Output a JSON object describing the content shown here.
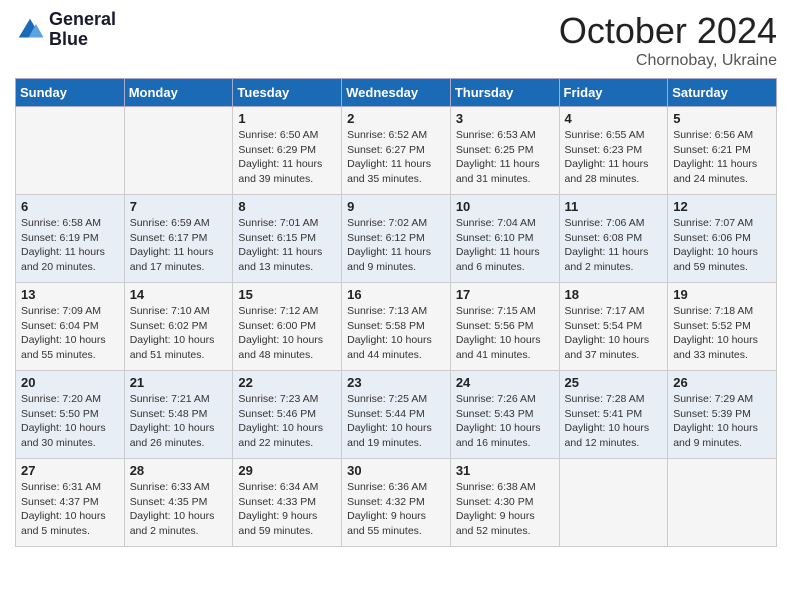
{
  "header": {
    "logo_line1": "General",
    "logo_line2": "Blue",
    "month": "October 2024",
    "location": "Chornobay, Ukraine"
  },
  "days_of_week": [
    "Sunday",
    "Monday",
    "Tuesday",
    "Wednesday",
    "Thursday",
    "Friday",
    "Saturday"
  ],
  "weeks": [
    [
      {
        "day": "",
        "info": ""
      },
      {
        "day": "",
        "info": ""
      },
      {
        "day": "1",
        "info": "Sunrise: 6:50 AM\nSunset: 6:29 PM\nDaylight: 11 hours and 39 minutes."
      },
      {
        "day": "2",
        "info": "Sunrise: 6:52 AM\nSunset: 6:27 PM\nDaylight: 11 hours and 35 minutes."
      },
      {
        "day": "3",
        "info": "Sunrise: 6:53 AM\nSunset: 6:25 PM\nDaylight: 11 hours and 31 minutes."
      },
      {
        "day": "4",
        "info": "Sunrise: 6:55 AM\nSunset: 6:23 PM\nDaylight: 11 hours and 28 minutes."
      },
      {
        "day": "5",
        "info": "Sunrise: 6:56 AM\nSunset: 6:21 PM\nDaylight: 11 hours and 24 minutes."
      }
    ],
    [
      {
        "day": "6",
        "info": "Sunrise: 6:58 AM\nSunset: 6:19 PM\nDaylight: 11 hours and 20 minutes."
      },
      {
        "day": "7",
        "info": "Sunrise: 6:59 AM\nSunset: 6:17 PM\nDaylight: 11 hours and 17 minutes."
      },
      {
        "day": "8",
        "info": "Sunrise: 7:01 AM\nSunset: 6:15 PM\nDaylight: 11 hours and 13 minutes."
      },
      {
        "day": "9",
        "info": "Sunrise: 7:02 AM\nSunset: 6:12 PM\nDaylight: 11 hours and 9 minutes."
      },
      {
        "day": "10",
        "info": "Sunrise: 7:04 AM\nSunset: 6:10 PM\nDaylight: 11 hours and 6 minutes."
      },
      {
        "day": "11",
        "info": "Sunrise: 7:06 AM\nSunset: 6:08 PM\nDaylight: 11 hours and 2 minutes."
      },
      {
        "day": "12",
        "info": "Sunrise: 7:07 AM\nSunset: 6:06 PM\nDaylight: 10 hours and 59 minutes."
      }
    ],
    [
      {
        "day": "13",
        "info": "Sunrise: 7:09 AM\nSunset: 6:04 PM\nDaylight: 10 hours and 55 minutes."
      },
      {
        "day": "14",
        "info": "Sunrise: 7:10 AM\nSunset: 6:02 PM\nDaylight: 10 hours and 51 minutes."
      },
      {
        "day": "15",
        "info": "Sunrise: 7:12 AM\nSunset: 6:00 PM\nDaylight: 10 hours and 48 minutes."
      },
      {
        "day": "16",
        "info": "Sunrise: 7:13 AM\nSunset: 5:58 PM\nDaylight: 10 hours and 44 minutes."
      },
      {
        "day": "17",
        "info": "Sunrise: 7:15 AM\nSunset: 5:56 PM\nDaylight: 10 hours and 41 minutes."
      },
      {
        "day": "18",
        "info": "Sunrise: 7:17 AM\nSunset: 5:54 PM\nDaylight: 10 hours and 37 minutes."
      },
      {
        "day": "19",
        "info": "Sunrise: 7:18 AM\nSunset: 5:52 PM\nDaylight: 10 hours and 33 minutes."
      }
    ],
    [
      {
        "day": "20",
        "info": "Sunrise: 7:20 AM\nSunset: 5:50 PM\nDaylight: 10 hours and 30 minutes."
      },
      {
        "day": "21",
        "info": "Sunrise: 7:21 AM\nSunset: 5:48 PM\nDaylight: 10 hours and 26 minutes."
      },
      {
        "day": "22",
        "info": "Sunrise: 7:23 AM\nSunset: 5:46 PM\nDaylight: 10 hours and 22 minutes."
      },
      {
        "day": "23",
        "info": "Sunrise: 7:25 AM\nSunset: 5:44 PM\nDaylight: 10 hours and 19 minutes."
      },
      {
        "day": "24",
        "info": "Sunrise: 7:26 AM\nSunset: 5:43 PM\nDaylight: 10 hours and 16 minutes."
      },
      {
        "day": "25",
        "info": "Sunrise: 7:28 AM\nSunset: 5:41 PM\nDaylight: 10 hours and 12 minutes."
      },
      {
        "day": "26",
        "info": "Sunrise: 7:29 AM\nSunset: 5:39 PM\nDaylight: 10 hours and 9 minutes."
      }
    ],
    [
      {
        "day": "27",
        "info": "Sunrise: 6:31 AM\nSunset: 4:37 PM\nDaylight: 10 hours and 5 minutes."
      },
      {
        "day": "28",
        "info": "Sunrise: 6:33 AM\nSunset: 4:35 PM\nDaylight: 10 hours and 2 minutes."
      },
      {
        "day": "29",
        "info": "Sunrise: 6:34 AM\nSunset: 4:33 PM\nDaylight: 9 hours and 59 minutes."
      },
      {
        "day": "30",
        "info": "Sunrise: 6:36 AM\nSunset: 4:32 PM\nDaylight: 9 hours and 55 minutes."
      },
      {
        "day": "31",
        "info": "Sunrise: 6:38 AM\nSunset: 4:30 PM\nDaylight: 9 hours and 52 minutes."
      },
      {
        "day": "",
        "info": ""
      },
      {
        "day": "",
        "info": ""
      }
    ]
  ]
}
